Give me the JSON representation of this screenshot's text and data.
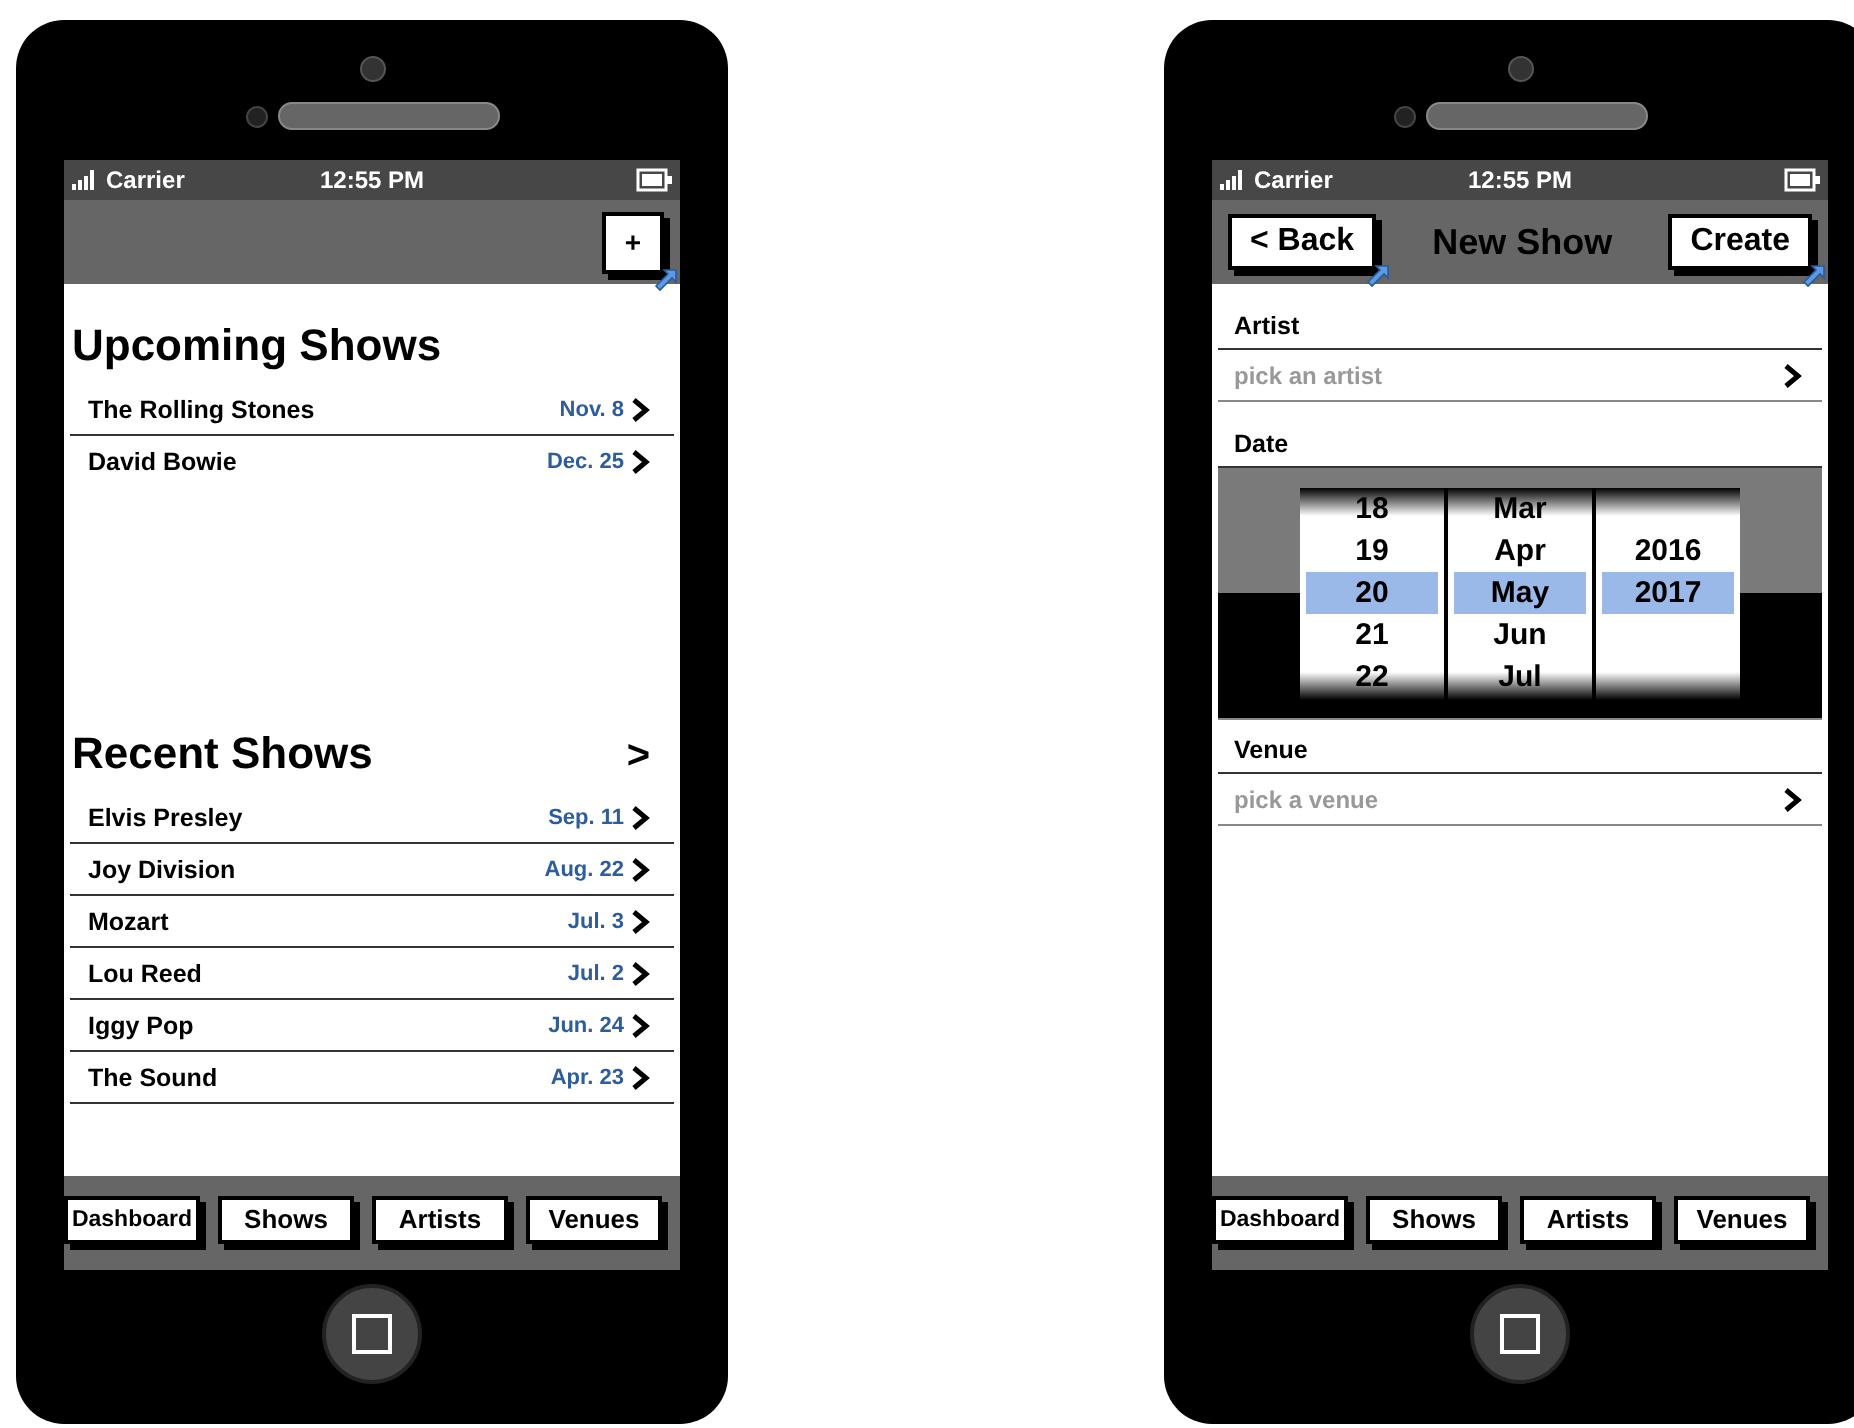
{
  "phones": [
    {
      "kind": "list",
      "status_bar": {
        "carrier": "Carrier",
        "time": "12:55 PM"
      },
      "nav_bar": {
        "action": "+"
      },
      "sections": [
        {
          "title": "Upcoming Shows",
          "rows": [
            {
              "name": "The Rolling Stones",
              "date": "Nov. 8"
            },
            {
              "name": "David Bowie",
              "date": "Dec. 25"
            }
          ]
        },
        {
          "title": "Recent Shows",
          "more": ">",
          "rows": [
            {
              "name": "Elvis Presley",
              "date": "Sep. 11"
            },
            {
              "name": "Joy Division",
              "date": "Aug. 22"
            },
            {
              "name": "Mozart",
              "date": "Jul. 3"
            },
            {
              "name": "Lou Reed",
              "date": "Jul. 2"
            },
            {
              "name": "Iggy Pop",
              "date": "Jun. 24"
            },
            {
              "name": "The Sound",
              "date": "Apr. 23"
            }
          ]
        }
      ],
      "tab_bar": [
        "Dashboard",
        "Shows",
        "Artists",
        "Venues"
      ]
    },
    {
      "kind": "form",
      "status_bar": {
        "carrier": "Carrier",
        "time": "12:55 PM"
      },
      "nav_bar": {
        "back": "< Back",
        "title": "New Show",
        "action": "Create"
      },
      "fields": [
        {
          "kind": "select",
          "label": "Artist",
          "placeholder": "pick an artist"
        },
        {
          "kind": "picker",
          "label": "Date",
          "columns": [
            {
              "items": [
                {
                  "text": "18",
                  "selected": false
                },
                {
                  "text": "19",
                  "selected": false
                },
                {
                  "text": "20",
                  "selected": true
                },
                {
                  "text": "21",
                  "selected": false
                },
                {
                  "text": "22",
                  "selected": false
                }
              ]
            },
            {
              "items": [
                {
                  "text": "Mar",
                  "selected": false
                },
                {
                  "text": "Apr",
                  "selected": false
                },
                {
                  "text": "May",
                  "selected": true
                },
                {
                  "text": "Jun",
                  "selected": false
                },
                {
                  "text": "Jul",
                  "selected": false
                }
              ]
            },
            {
              "items": [
                {
                  "text": "2016",
                  "selected": false
                },
                {
                  "text": "2017",
                  "selected": true
                }
              ]
            }
          ]
        },
        {
          "kind": "select",
          "label": "Venue",
          "placeholder": "pick a venue"
        }
      ],
      "tab_bar": [
        "Dashboard",
        "Shows",
        "Artists",
        "Venues"
      ]
    }
  ]
}
